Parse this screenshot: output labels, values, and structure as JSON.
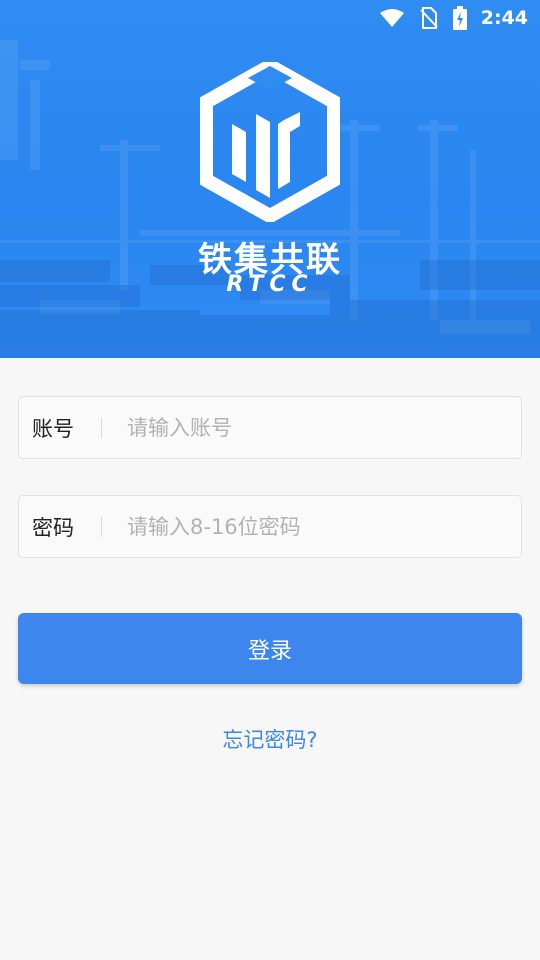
{
  "status_bar": {
    "time": "2:44",
    "icons": [
      "wifi-icon",
      "no-sim-icon",
      "battery-charging-icon"
    ]
  },
  "brand": {
    "name_cn": "铁集共联",
    "name_en": "RTCC"
  },
  "form": {
    "account_label": "账号",
    "account_placeholder": "请输入账号",
    "password_label": "密码",
    "password_placeholder": "请输入8-16位密码",
    "login_label": "登录",
    "forgot_label": "忘记密码?"
  },
  "colors": {
    "hero_blue": "#2f8cf2",
    "button_blue": "#3d86ee",
    "link_blue": "#3d86ee",
    "page_bg": "#f7f7f7"
  }
}
